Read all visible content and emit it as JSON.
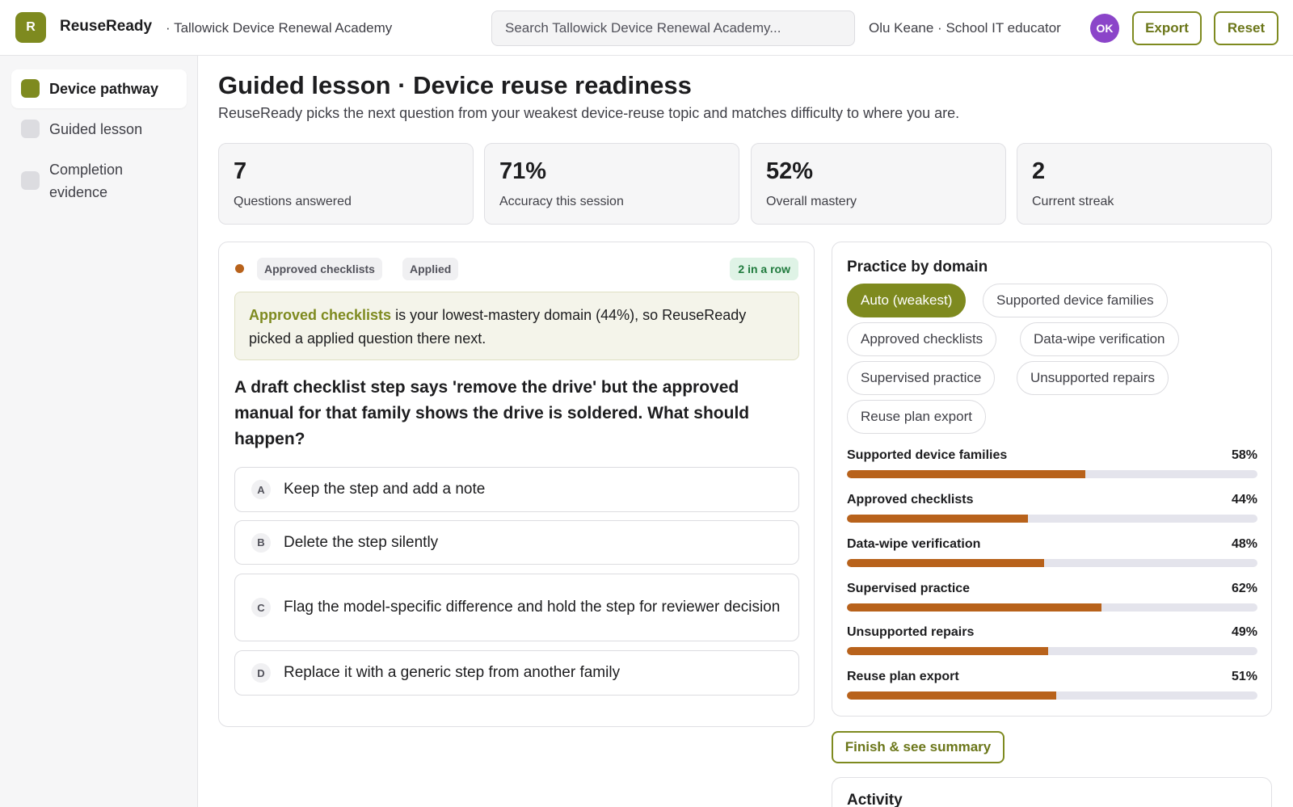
{
  "header": {
    "logo_letter": "R",
    "brand": "ReuseReady",
    "org": "· Tallowick Device Renewal Academy",
    "search_placeholder": "Search Tallowick Device Renewal Academy...",
    "user": "Olu Keane · School IT educator",
    "avatar_initials": "OK",
    "export_label": "Export",
    "reset_label": "Reset"
  },
  "sidebar": {
    "items": [
      {
        "label": "Device pathway",
        "active": true
      },
      {
        "label": "Guided lesson",
        "active": false
      },
      {
        "label": "Completion evidence",
        "active": false
      }
    ]
  },
  "main": {
    "title": "Guided lesson · Device reuse readiness",
    "subtitle": "ReuseReady picks the next question from your weakest device-reuse topic and matches difficulty to where you are.",
    "stats": [
      {
        "value": "7",
        "label": "Questions answered"
      },
      {
        "value": "71%",
        "label": "Accuracy this session"
      },
      {
        "value": "52%",
        "label": "Overall mastery"
      },
      {
        "value": "2",
        "label": "Current streak"
      }
    ]
  },
  "question_card": {
    "domain_tag": "Approved checklists",
    "type_tag": "Applied",
    "streak": "2 in a row",
    "explain_highlight": "Approved checklists",
    "explain_rest": " is your lowest-mastery domain (44%), so ReuseReady picked a applied question there next.",
    "question": "A draft checklist step says 'remove the drive' but the approved manual for that family shows the drive is soldered. What should happen?",
    "options": [
      {
        "letter": "A",
        "text": "Keep the step and add a note"
      },
      {
        "letter": "B",
        "text": "Delete the step silently"
      },
      {
        "letter": "C",
        "text": "Flag the model-specific difference and hold the step for reviewer decision"
      },
      {
        "letter": "D",
        "text": "Replace it with a generic step from another family"
      }
    ]
  },
  "practice": {
    "title": "Practice by domain",
    "chips": [
      {
        "label": "Auto (weakest)",
        "active": true
      },
      {
        "label": "Supported device families",
        "active": false
      },
      {
        "label": "Approved checklists",
        "active": false
      },
      {
        "label": "Data-wipe verification",
        "active": false
      },
      {
        "label": "Supervised practice",
        "active": false
      },
      {
        "label": "Unsupported repairs",
        "active": false
      },
      {
        "label": "Reuse plan export",
        "active": false
      }
    ],
    "domains": [
      {
        "name": "Supported device families",
        "pct_label": "58%",
        "value": 58
      },
      {
        "name": "Approved checklists",
        "pct_label": "44%",
        "value": 44
      },
      {
        "name": "Data-wipe verification",
        "pct_label": "48%",
        "value": 48
      },
      {
        "name": "Supervised practice",
        "pct_label": "62%",
        "value": 62
      },
      {
        "name": "Unsupported repairs",
        "pct_label": "49%",
        "value": 49
      },
      {
        "name": "Reuse plan export",
        "pct_label": "51%",
        "value": 51
      }
    ]
  },
  "finish_label": "Finish & see summary",
  "activity_title": "Activity",
  "colors": {
    "accent": "#7e8a1f",
    "bar": "#b8621b",
    "avatar": "#8b45c9",
    "streak_bg": "#dff3e6"
  }
}
